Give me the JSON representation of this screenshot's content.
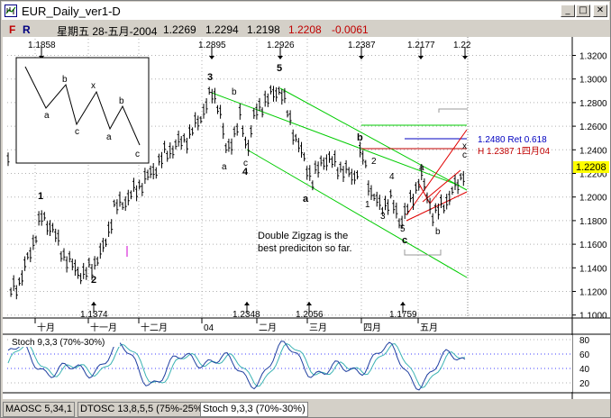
{
  "window": {
    "title": "EUR_Daily_ver1-D",
    "min_glyph": "_",
    "max_glyph": "□",
    "close_glyph": "✕"
  },
  "infobar": {
    "f_label": "F",
    "r_label": "R",
    "date_text": "星期五 28-五月-2004",
    "open": "1.2269",
    "high": "1.2294",
    "low": "1.2198",
    "close": "1.2208",
    "change": "-0.0061",
    "colors": {
      "f": "#c00000",
      "r": "#000080",
      "close": "#c00000",
      "change": "#c00000"
    }
  },
  "price_axis": {
    "ticks": [
      "1.3200",
      "1.3000",
      "1.2800",
      "1.2600",
      "1.2400",
      "1.2200",
      "1.2000",
      "1.1800",
      "1.1600",
      "1.1400",
      "1.1200",
      "1.1000"
    ],
    "current": "1.2208",
    "current_bg": "#ffff00"
  },
  "date_axis": [
    "十月",
    "十一月",
    "十二月",
    "04",
    "二月",
    "三月",
    "四月",
    "五月"
  ],
  "top_marks": [
    "1.1858",
    "1.2895",
    "1.2926",
    "1.2387",
    "1.2177",
    "1.22"
  ],
  "bottom_marks": [
    "1.1374",
    "1.2348",
    "1.2056",
    "1.1759"
  ],
  "wave_labels": {
    "w1": "1",
    "w2": "2",
    "w3": "3",
    "wa1": "a",
    "wb1": "b",
    "wc1": "c",
    "w4": "4",
    "w5": "5",
    "wa2": "a",
    "wb2": "b",
    "s1": "1",
    "s2": "2",
    "s3": "3",
    "s4": "4",
    "s5": "5",
    "sa": "a",
    "sb": "b",
    "sc": "c",
    "sC": "c",
    "sx": "x"
  },
  "pattern_labels": {
    "a1": "a",
    "b1": "b",
    "c1": "c",
    "x": "x",
    "a2": "a",
    "b2": "b",
    "c2": "c"
  },
  "annotations": {
    "ret": "1.2480 Ret 0.618",
    "h": "H 1.2387 1四月04",
    "note_line1": "Double Zigzag is the",
    "note_line2": "best prediciton so far."
  },
  "stoch": {
    "label": "Stoch 9,3,3 (70%-30%)",
    "ticks": [
      "80",
      "60",
      "40",
      "20"
    ]
  },
  "tabs": [
    "MAOSC 5,34,1",
    "DTOSC 13,8,5,5 (75%-25%)",
    "Stoch 9,3,3 (70%-30%)"
  ],
  "colors": {
    "channel": "#00cc00",
    "fib_line": "#0000c0",
    "h_line": "#c00000",
    "wedge": "#e00000",
    "stoch_k": "#1f3f9f",
    "stoch_d": "#3cb3b3"
  }
}
